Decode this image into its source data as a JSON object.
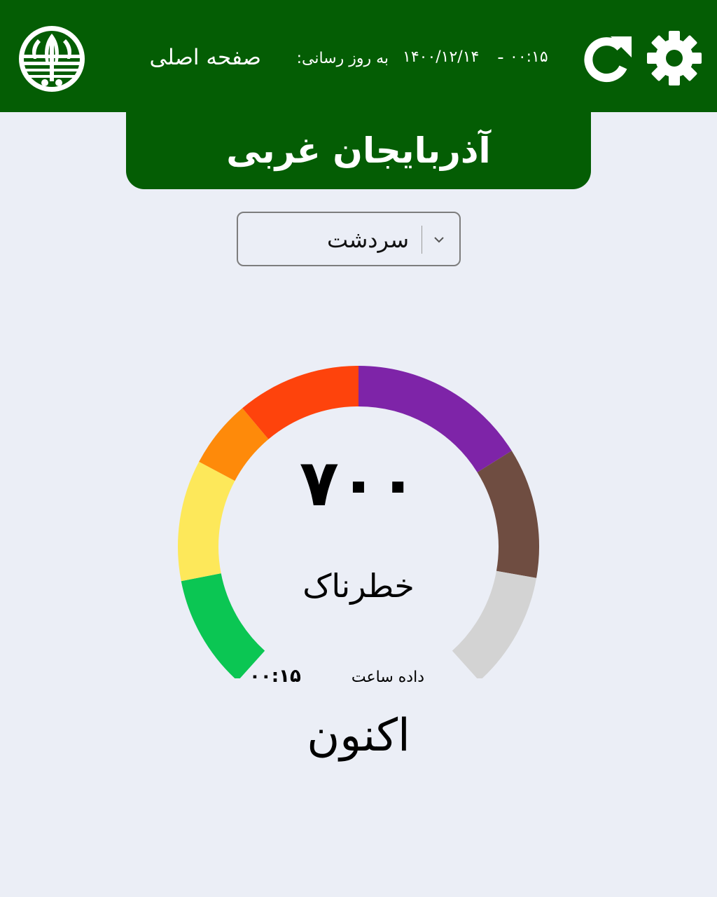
{
  "header": {
    "home_title": "صفحه اصلی",
    "update_label": "به روز رسانی:",
    "update_date": "۱۴۰۰/۱۲/۱۴",
    "update_separator": "-",
    "update_time": "۰۰:۱۵",
    "logo_icon": "doe-logo-icon",
    "refresh_icon": "refresh-icon",
    "settings_icon": "gear-icon",
    "background_color": "#045d04"
  },
  "province": {
    "name": "آذربایجان غربی"
  },
  "city_select": {
    "selected": "سردشت"
  },
  "gauge": {
    "value": "۷۰۰",
    "status": "خطرناک",
    "data_time_label": "داده ساعت",
    "data_time": "۰۰:۱۵",
    "period": "اکنون",
    "segments": [
      {
        "level": "good",
        "color": "#0bc653"
      },
      {
        "level": "moderate",
        "color": "#fde85a"
      },
      {
        "level": "unhealthy-sensitive",
        "color": "#fe8a0a"
      },
      {
        "level": "unhealthy",
        "color": "#fe430c"
      },
      {
        "level": "very-unhealthy",
        "color": "#7e24a8"
      },
      {
        "level": "hazardous",
        "color": "#6f4d41"
      },
      {
        "level": "no-data",
        "color": "#d3d3d3"
      }
    ]
  }
}
